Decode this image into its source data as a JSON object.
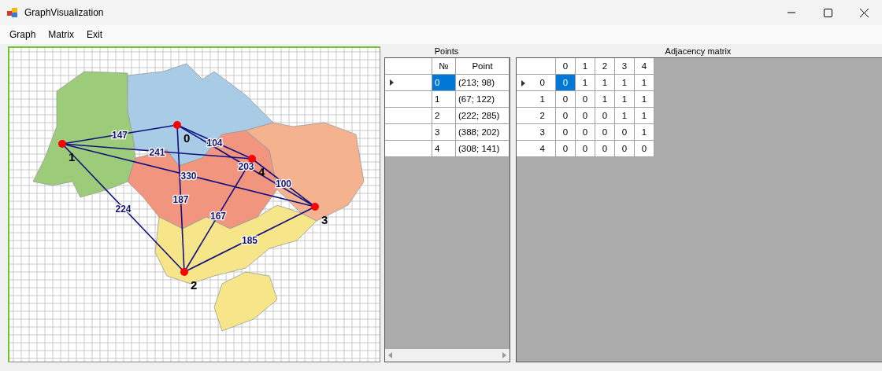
{
  "window": {
    "title": "GraphVisualization"
  },
  "menu": [
    {
      "label": "Graph"
    },
    {
      "label": "Matrix"
    },
    {
      "label": "Exit"
    }
  ],
  "graph": {
    "nodes": [
      {
        "label": "0"
      },
      {
        "label": "1"
      },
      {
        "label": "2"
      },
      {
        "label": "3"
      },
      {
        "label": "4"
      }
    ],
    "edge_weights": [
      "147",
      "187",
      "203",
      "104",
      "224",
      "330",
      "241",
      "185",
      "167",
      "100"
    ]
  },
  "points": {
    "title": "Points",
    "columns": [
      "№",
      "Point"
    ],
    "rows": [
      {
        "current": true,
        "selected": true,
        "cells": [
          "0",
          "(213; 98)"
        ]
      },
      {
        "current": false,
        "selected": false,
        "cells": [
          "1",
          "(67; 122)"
        ]
      },
      {
        "current": false,
        "selected": false,
        "cells": [
          "2",
          "(222; 285)"
        ]
      },
      {
        "current": false,
        "selected": false,
        "cells": [
          "3",
          "(388; 202)"
        ]
      },
      {
        "current": false,
        "selected": false,
        "cells": [
          "4",
          "(308; 141)"
        ]
      }
    ]
  },
  "matrix": {
    "title": "Adjacency matrix",
    "columns": [
      "0",
      "1",
      "2",
      "3",
      "4"
    ],
    "rows": [
      {
        "header": "0",
        "current": true,
        "cells": [
          {
            "value": "0",
            "selected": true
          },
          {
            "value": "1",
            "selected": false
          },
          {
            "value": "1",
            "selected": false
          },
          {
            "value": "1",
            "selected": false
          },
          {
            "value": "1",
            "selected": false
          }
        ]
      },
      {
        "header": "1",
        "current": false,
        "cells": [
          {
            "value": "0",
            "selected": false
          },
          {
            "value": "0",
            "selected": false
          },
          {
            "value": "1",
            "selected": false
          },
          {
            "value": "1",
            "selected": false
          },
          {
            "value": "1",
            "selected": false
          }
        ]
      },
      {
        "header": "2",
        "current": false,
        "cells": [
          {
            "value": "0",
            "selected": false
          },
          {
            "value": "0",
            "selected": false
          },
          {
            "value": "0",
            "selected": false
          },
          {
            "value": "1",
            "selected": false
          },
          {
            "value": "1",
            "selected": false
          }
        ]
      },
      {
        "header": "3",
        "current": false,
        "cells": [
          {
            "value": "0",
            "selected": false
          },
          {
            "value": "0",
            "selected": false
          },
          {
            "value": "0",
            "selected": false
          },
          {
            "value": "0",
            "selected": false
          },
          {
            "value": "1",
            "selected": false
          }
        ]
      },
      {
        "header": "4",
        "current": false,
        "cells": [
          {
            "value": "0",
            "selected": false
          },
          {
            "value": "0",
            "selected": false
          },
          {
            "value": "0",
            "selected": false
          },
          {
            "value": "0",
            "selected": false
          },
          {
            "value": "0",
            "selected": false
          }
        ]
      }
    ]
  }
}
